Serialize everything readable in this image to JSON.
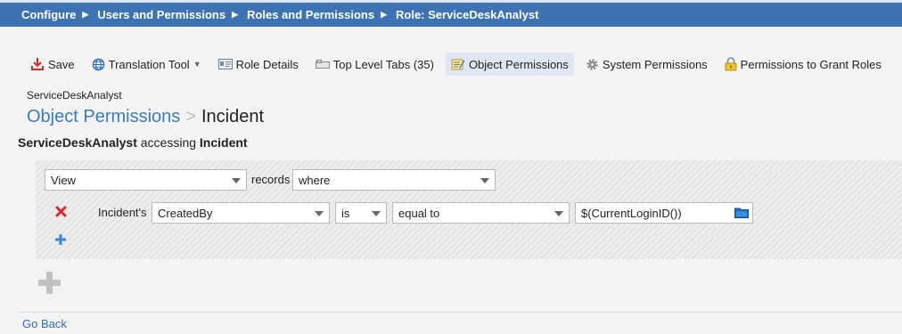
{
  "breadcrumb": {
    "items": [
      "Configure",
      "Users and Permissions",
      "Roles and Permissions",
      "Role: ServiceDeskAnalyst"
    ]
  },
  "toolbar": {
    "save": "Save",
    "translation_tool": "Translation Tool",
    "role_details": "Role Details",
    "top_level_tabs": "Top Level Tabs (35)",
    "object_permissions": "Object Permissions",
    "system_permissions": "System Permissions",
    "permissions_to_grant_roles": "Permissions to Grant Roles"
  },
  "header": {
    "role_name": "ServiceDeskAnalyst",
    "title": "Object Permissions",
    "title_separator": ">",
    "object_name": "Incident",
    "subtitle_role": "ServiceDeskAnalyst",
    "subtitle_mid": " accessing ",
    "subtitle_object": "Incident"
  },
  "rule": {
    "action_value": "View",
    "records_label": "records",
    "where_value": "where",
    "condition": {
      "prefix_label": "Incident's",
      "field_value": "CreatedBy",
      "operator_value": "is",
      "comparison_value": "equal to",
      "value_input": "$(CurrentLoginID())"
    }
  },
  "footer": {
    "go_back": "Go Back"
  },
  "colors": {
    "header_blue": "#3d72b3",
    "title_blue": "#3b7bbd",
    "delete_red": "#d42a2a",
    "add_blue": "#3a86d6"
  },
  "icons": [
    "save-icon",
    "globe-icon",
    "id-card-icon",
    "tabs-icon",
    "object-permissions-icon",
    "gear-icon",
    "lock-icon",
    "delete-icon",
    "add-condition-icon",
    "folder-icon",
    "add-rule-icon"
  ]
}
